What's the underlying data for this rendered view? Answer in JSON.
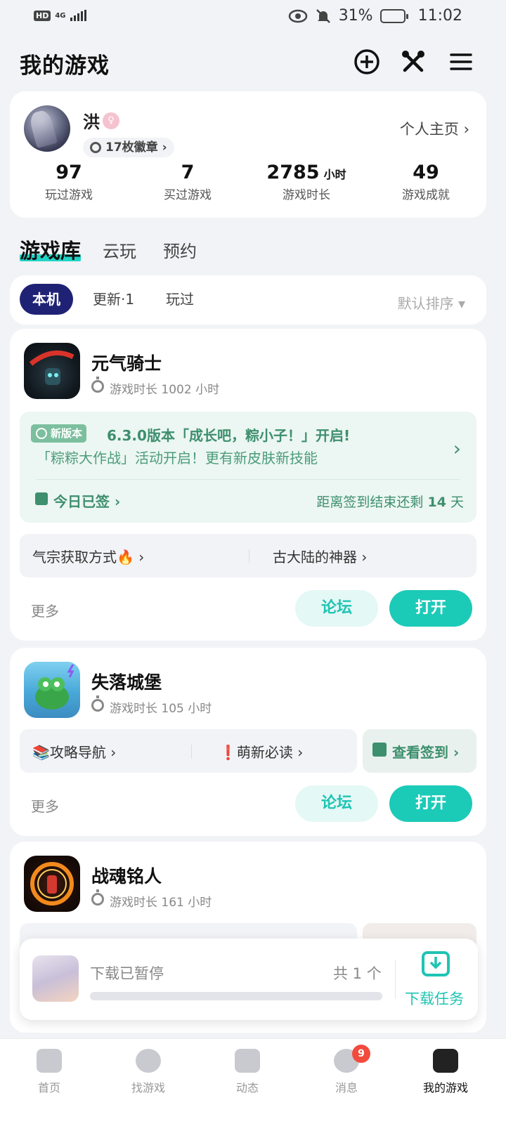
{
  "status_bar": {
    "network": "HD",
    "signal_label": "4G",
    "battery": "31%",
    "time": "11:02"
  },
  "header": {
    "title": "我的游戏"
  },
  "profile": {
    "name": "洪",
    "medals": "17枚徽章 ›",
    "home_link": "个人主页 ›",
    "stats": [
      {
        "value": "97",
        "unit": "",
        "label": "玩过游戏"
      },
      {
        "value": "7",
        "unit": "",
        "label": "买过游戏"
      },
      {
        "value": "2785",
        "unit": "小时",
        "label": "游戏时长"
      },
      {
        "value": "49",
        "unit": "",
        "label": "游戏成就"
      }
    ]
  },
  "main_tabs": [
    "游戏库",
    "云玩",
    "预约"
  ],
  "sub_tabs": [
    "本机",
    "更新·1",
    "玩过"
  ],
  "sort_label": "默认排序 ▾",
  "games": [
    {
      "name": "元气骑士",
      "playtime": "游戏时长 1002 小时",
      "news": {
        "tag": "新版本",
        "headline": "6.3.0版本「成长吧，粽小子！」开启!",
        "sub": "「粽粽大作战」活动开启！更有新皮肤新技能",
        "signed": "今日已签 ›",
        "remain_prefix": "距离签到结束还剩",
        "remain_days": "14",
        "remain_suffix": "天"
      },
      "links": [
        "气宗获取方式🔥 ›",
        "古大陆的神器 ›"
      ],
      "more": "更多",
      "forum": "论坛",
      "open": "打开"
    },
    {
      "name": "失落城堡",
      "playtime": "游戏时长 105 小时",
      "links": [
        "📚攻略导航 ›",
        "❗萌新必读 ›"
      ],
      "signin": "查看签到 ›",
      "more": "更多",
      "forum": "论坛",
      "open": "打开"
    },
    {
      "name": "战魂铭人",
      "playtime": "游戏时长 161 小时"
    }
  ],
  "download": {
    "status": "下载已暂停",
    "count": "共 1 个",
    "task_label": "下载任务"
  },
  "nav": [
    {
      "label": "首页"
    },
    {
      "label": "找游戏"
    },
    {
      "label": "动态"
    },
    {
      "label": "消息",
      "badge": "9"
    },
    {
      "label": "我的游戏"
    }
  ]
}
